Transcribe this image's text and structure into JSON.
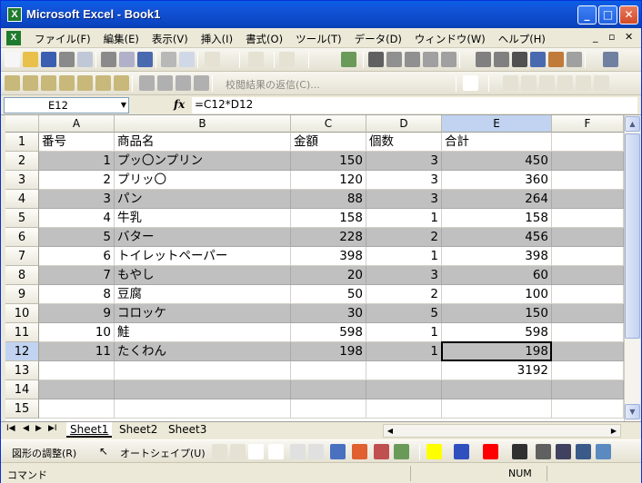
{
  "window": {
    "title": "Microsoft Excel - Book1",
    "app_icon": "excel-icon"
  },
  "menu": {
    "items": [
      "ファイル(F)",
      "編集(E)",
      "表示(V)",
      "挿入(I)",
      "書式(O)",
      "ツール(T)",
      "データ(D)",
      "ウィンドウ(W)",
      "ヘルプ(H)"
    ]
  },
  "toolbar2": {
    "review_label": "校閲結果の返信(C)..."
  },
  "formula_bar": {
    "name_box": "E12",
    "fx": "fx",
    "formula": "=C12*D12"
  },
  "columns": [
    "A",
    "B",
    "C",
    "D",
    "E",
    "F"
  ],
  "rows": [
    {
      "n": "1",
      "a": "番号",
      "b": "商品名",
      "c": "金額",
      "d": "個数",
      "e": "合計",
      "shade": false
    },
    {
      "n": "2",
      "a": "1",
      "b": "プッ〇ンプリン",
      "c": "150",
      "d": "3",
      "e": "450",
      "shade": true
    },
    {
      "n": "3",
      "a": "2",
      "b": "プリッ〇",
      "c": "120",
      "d": "3",
      "e": "360",
      "shade": false
    },
    {
      "n": "4",
      "a": "3",
      "b": "パン",
      "c": "88",
      "d": "3",
      "e": "264",
      "shade": true
    },
    {
      "n": "5",
      "a": "4",
      "b": "牛乳",
      "c": "158",
      "d": "1",
      "e": "158",
      "shade": false
    },
    {
      "n": "6",
      "a": "5",
      "b": "バター",
      "c": "228",
      "d": "2",
      "e": "456",
      "shade": true
    },
    {
      "n": "7",
      "a": "6",
      "b": "トイレットペーパー",
      "c": "398",
      "d": "1",
      "e": "398",
      "shade": false
    },
    {
      "n": "8",
      "a": "7",
      "b": "もやし",
      "c": "20",
      "d": "3",
      "e": "60",
      "shade": true
    },
    {
      "n": "9",
      "a": "8",
      "b": "豆腐",
      "c": "50",
      "d": "2",
      "e": "100",
      "shade": false
    },
    {
      "n": "10",
      "a": "9",
      "b": "コロッケ",
      "c": "30",
      "d": "5",
      "e": "150",
      "shade": true
    },
    {
      "n": "11",
      "a": "10",
      "b": "鮭",
      "c": "598",
      "d": "1",
      "e": "598",
      "shade": false
    },
    {
      "n": "12",
      "a": "11",
      "b": "たくわん",
      "c": "198",
      "d": "1",
      "e": "198",
      "shade": true
    },
    {
      "n": "13",
      "a": "",
      "b": "",
      "c": "",
      "d": "",
      "e": "3192",
      "shade": false
    },
    {
      "n": "14",
      "a": "",
      "b": "",
      "c": "",
      "d": "",
      "e": "",
      "shade": true
    },
    {
      "n": "15",
      "a": "",
      "b": "",
      "c": "",
      "d": "",
      "e": "",
      "shade": false
    }
  ],
  "sheets": {
    "tabs": [
      "Sheet1",
      "Sheet2",
      "Sheet3"
    ],
    "active": "Sheet1"
  },
  "drawbar": {
    "adjust": "図形の調整(R)",
    "autoshape": "オートシェイプ(U)"
  },
  "status": {
    "mode": "コマンド",
    "num": "NUM"
  },
  "colors": {
    "shade": "#c0c0c0",
    "selected_header": "#c1d3f0",
    "title_blue": "#0a5fe6"
  }
}
